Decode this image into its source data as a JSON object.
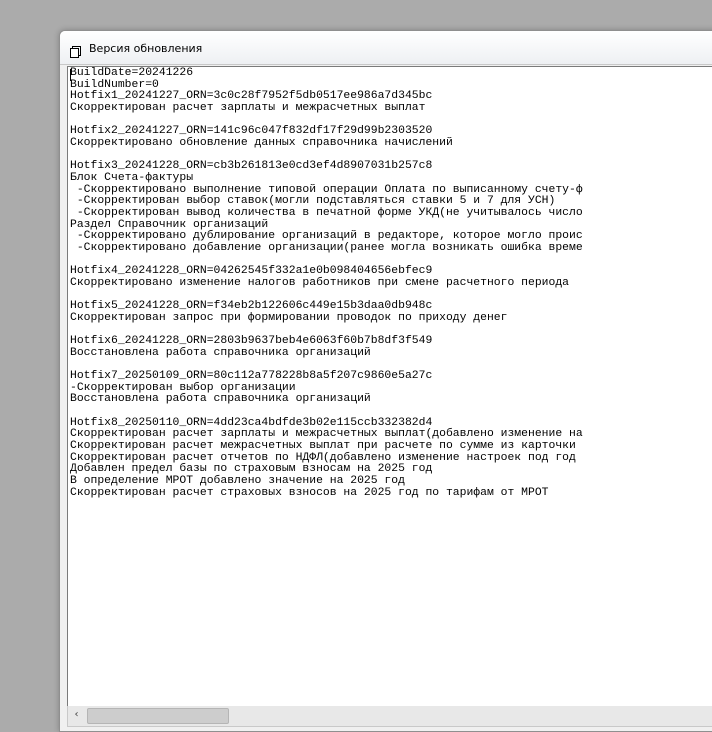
{
  "window": {
    "title": "Версия обновления",
    "icon": "document-icon"
  },
  "content": {
    "lines": [
      "BuildDate=20241226",
      "BuildNumber=0",
      "Hotfix1_20241227_ORN=3c0c28f7952f5db0517ee986a7d345bc",
      "Скорректирован расчет зарплаты и межрасчетных выплат",
      "",
      "Hotfix2_20241227_ORN=141c96c047f832df17f29d99b2303520",
      "Скорректировано обновление данных справочника начислений",
      "",
      "Hotfix3_20241228_ORN=cb3b261813e0cd3ef4d8907031b257c8",
      "Блок Счета-фактуры",
      " -Скорректировано выполнение типовой операции Оплата по выписанному счету-ф",
      " -Скорректирован выбор ставок(могли подставляться ставки 5 и 7 для УСН)",
      " -Скорректирован вывод количества в печатной форме УКД(не учитывалось число",
      "Раздел Справочник организаций",
      " -Скорректировано дублирование организаций в редакторе, которое могло проис",
      " -Скорректировано добавление организации(ранее могла возникать ошибка време",
      "",
      "Hotfix4_20241228_ORN=04262545f332a1e0b098404656ebfec9",
      "Скорректировано изменение налогов работников при смене расчетного периода",
      "",
      "Hotfix5_20241228_ORN=f34eb2b122606c449e15b3daa0db948c",
      "Скорректирован запрос при формировании проводок по приходу денег",
      "",
      "Hotfix6_20241228_ORN=2803b9637beb4e6063f60b7b8df3f549",
      "Восстановлена работа справочника организаций",
      "",
      "Hotfix7_20250109_ORN=80c112a778228b8a5f207c9860e5a27c",
      "-Скорректирован выбор организации",
      "Восстановлена работа справочника организаций",
      "",
      "Hotfix8_20250110_ORN=4dd23ca4bdfde3b02e115ccb332382d4",
      "Скорректирован расчет зарплаты и межрасчетных выплат(добавлено изменение на",
      "Скорректирован расчет межрасчетных выплат при расчете по сумме из карточки ",
      "Скорректирован расчет отчетов по НДФЛ(добавлено изменение настроек под год ",
      "Добавлен предел базы по страховым взносам на 2025 год",
      "В определение МРОТ добавлено значение на 2025 год",
      "Скорректирован расчет страховых взносов на 2025 год по тарифам от МРОТ"
    ]
  },
  "scrollbar": {
    "left_arrow": "‹"
  }
}
